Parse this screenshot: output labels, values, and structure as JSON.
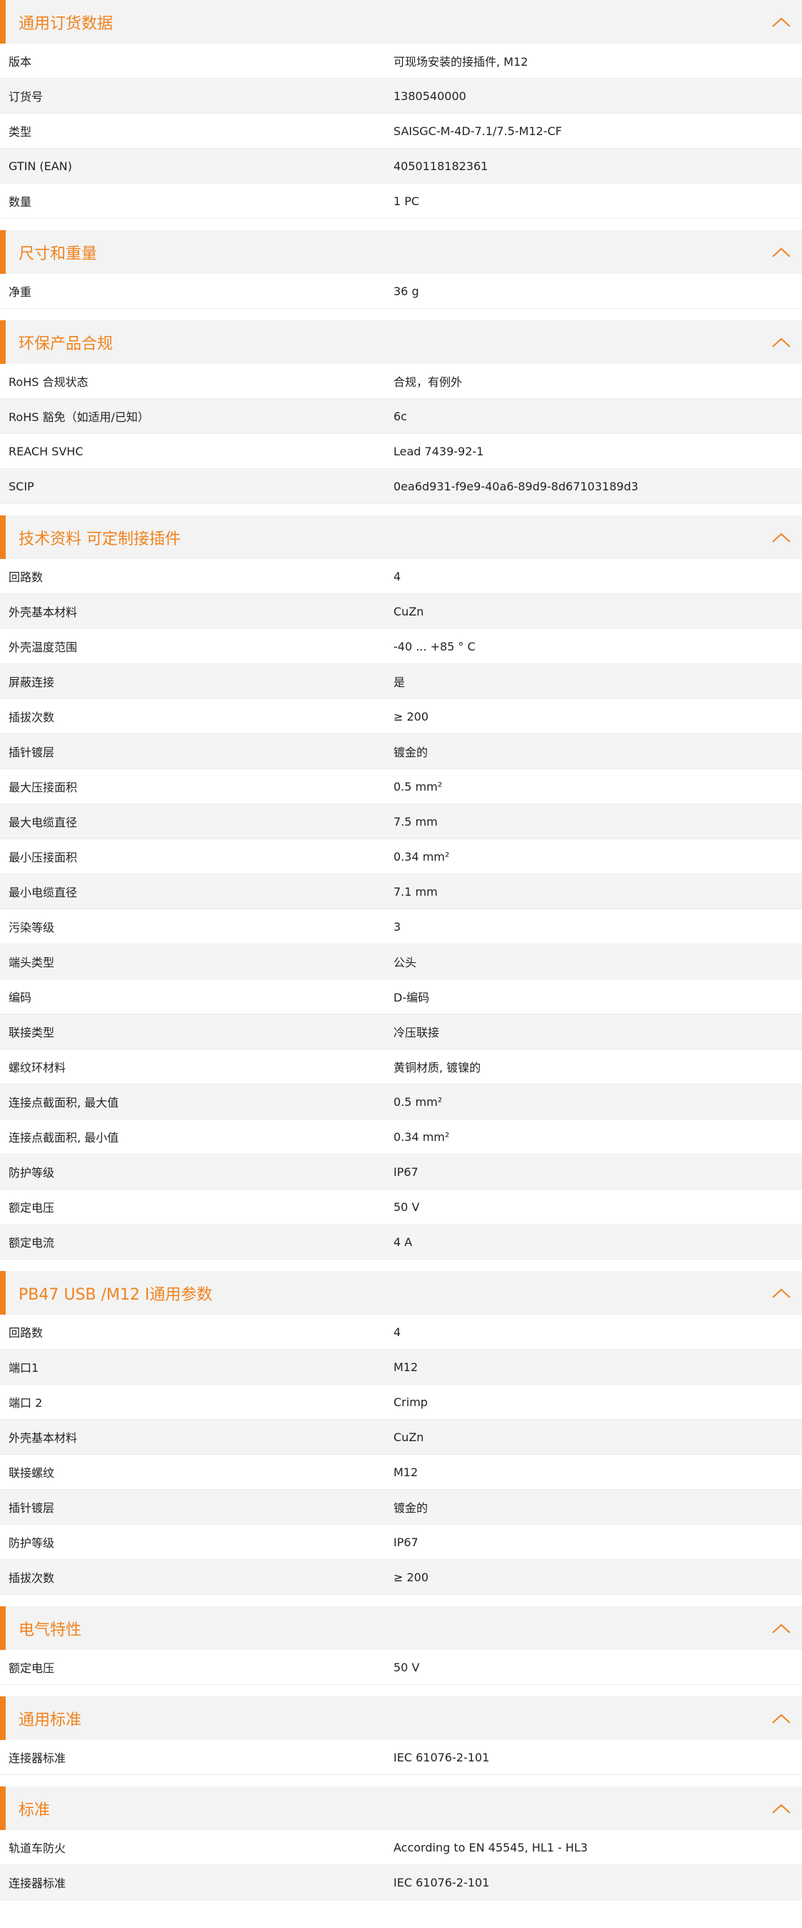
{
  "sections": [
    {
      "title": "通用订货数据",
      "rows": [
        {
          "label": "版本",
          "value": "可现场安装的接插件, M12"
        },
        {
          "label": "订货号",
          "value": "1380540000"
        },
        {
          "label": "类型",
          "value": "SAISGC-M-4D-7.1/7.5-M12-CF"
        },
        {
          "label": "GTIN (EAN)",
          "value": "4050118182361"
        },
        {
          "label": "数量",
          "value": "1  PC"
        }
      ]
    },
    {
      "title": "尺寸和重量",
      "rows": [
        {
          "label": "净重",
          "value": "36  g"
        }
      ]
    },
    {
      "title": "环保产品合规",
      "rows": [
        {
          "label": "RoHS 合规状态",
          "value": "合规，有例外"
        },
        {
          "label": "RoHS 豁免（如适用/已知）",
          "value": "6c"
        },
        {
          "label": "REACH SVHC",
          "value": "Lead 7439-92-1"
        },
        {
          "label": "SCIP",
          "value": "0ea6d931-f9e9-40a6-89d9-8d67103189d3"
        }
      ]
    },
    {
      "title": "技术资料 可定制接插件",
      "rows": [
        {
          "label": "回路数",
          "value": "4"
        },
        {
          "label": "外壳基本材料",
          "value": "CuZn"
        },
        {
          "label": "外壳温度范围",
          "value": "-40 ... +85 ° C"
        },
        {
          "label": "屏蔽连接",
          "value": "是"
        },
        {
          "label": "插拔次数",
          "value": "≥ 200"
        },
        {
          "label": "插针镀层",
          "value": "镀金的"
        },
        {
          "label": "最大压接面积",
          "value": "0.5  mm²"
        },
        {
          "label": "最大电缆直径",
          "value": "7.5  mm"
        },
        {
          "label": "最小压接面积",
          "value": "0.34  mm²"
        },
        {
          "label": "最小电缆直径",
          "value": "7.1  mm"
        },
        {
          "label": "污染等级",
          "value": "3"
        },
        {
          "label": "端头类型",
          "value": "公头"
        },
        {
          "label": "编码",
          "value": "D-编码"
        },
        {
          "label": "联接类型",
          "value": "冷压联接"
        },
        {
          "label": "螺纹环材料",
          "value": "黄铜材质, 镀镍的"
        },
        {
          "label": "连接点截面积, 最大值",
          "value": "0.5  mm²"
        },
        {
          "label": "连接点截面积, 最小值",
          "value": "0.34  mm²"
        },
        {
          "label": "防护等级",
          "value": "IP67"
        },
        {
          "label": "额定电压",
          "value": "50  V"
        },
        {
          "label": "额定电流",
          "value": "4  A"
        }
      ]
    },
    {
      "title": "PB47 USB /M12 I通用参数",
      "rows": [
        {
          "label": "回路数",
          "value": "4"
        },
        {
          "label": "端口1",
          "value": "M12"
        },
        {
          "label": "端口 2",
          "value": "Crimp"
        },
        {
          "label": "外壳基本材料",
          "value": "CuZn"
        },
        {
          "label": "联接螺纹",
          "value": "M12"
        },
        {
          "label": "插针镀层",
          "value": "镀金的"
        },
        {
          "label": "防护等级",
          "value": "IP67"
        },
        {
          "label": "插拔次数",
          "value": "≥ 200"
        }
      ]
    },
    {
      "title": "电气特性",
      "rows": [
        {
          "label": "额定电压",
          "value": "50  V"
        }
      ]
    },
    {
      "title": "通用标准",
      "rows": [
        {
          "label": "连接器标准",
          "value": "IEC 61076-2-101"
        }
      ]
    },
    {
      "title": "标准",
      "rows": [
        {
          "label": "轨道车防火",
          "value": "According to EN 45545, HL1 - HL3"
        },
        {
          "label": "连接器标准",
          "value": "IEC 61076-2-101"
        }
      ]
    }
  ],
  "icons": {
    "toggle": "chevron-up-icon"
  },
  "colors": {
    "accent": "#f0821e",
    "header_bg": "#f3f3f3",
    "row_alt": "#f4f4f4"
  }
}
